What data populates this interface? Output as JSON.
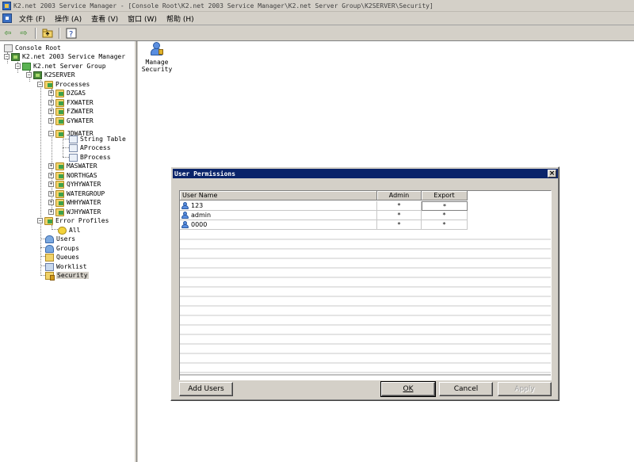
{
  "window": {
    "title": "K2.net 2003 Service Manager - [Console Root\\K2.net 2003 Service Manager\\K2.net Server Group\\K2SERVER\\Security]"
  },
  "menu": {
    "items": [
      "文件 (F)",
      "操作 (A)",
      "查看 (V)",
      "窗口 (W)",
      "帮助 (H)"
    ]
  },
  "toolbar": {
    "icons": [
      "back-icon",
      "forward-icon",
      "up-folder-icon",
      "help-icon"
    ],
    "back": "⇦",
    "forward": "⇨"
  },
  "tree": {
    "console_root": "Console Root",
    "service_manager": "K2.net 2003 Service Manager",
    "server_group": "K2.net Server Group",
    "server": "K2SERVER",
    "processes": "Processes",
    "process_items": [
      "DZGAS",
      "FXWATER",
      "FZWATER",
      "GYWATER",
      "JDWATER"
    ],
    "jdwater_children": [
      "String Table",
      "AProcess",
      "BProcess"
    ],
    "process_items_2": [
      "MASWATER",
      "NORTHGAS",
      "QYHYWATER",
      "WATERGROUP",
      "WHHYWATER",
      "WJHYWATER"
    ],
    "error_profiles": "Error Profiles",
    "error_all": "All",
    "users": "Users",
    "groups": "Groups",
    "queues": "Queues",
    "worklist": "Worklist",
    "security": "Security",
    "expand_plus": "+",
    "expand_minus": "−"
  },
  "right_pane": {
    "manage_security_line1": "Manage",
    "manage_security_line2": "Security"
  },
  "dialog": {
    "title": "User Permissions",
    "close": "×",
    "columns": [
      "User Name",
      "Admin",
      "Export"
    ],
    "rows": [
      {
        "user": "123",
        "admin": "*",
        "export": "*"
      },
      {
        "user": "admin",
        "admin": "*",
        "export": "*"
      },
      {
        "user": "0000",
        "admin": "*",
        "export": "*"
      }
    ],
    "add_users": "Add Users",
    "ok": "OK",
    "cancel": "Cancel",
    "apply": "Apply"
  }
}
